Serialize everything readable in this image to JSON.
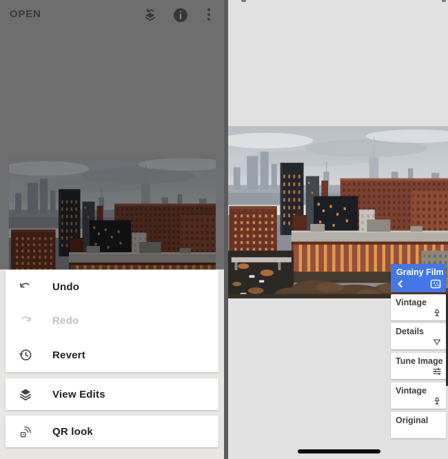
{
  "left_screen": {
    "toolbar": {
      "open_label": "OPEN",
      "icons": [
        "view-edits-history-icon",
        "info-icon",
        "overflow-menu-icon"
      ]
    },
    "menu": {
      "items": [
        {
          "label": "Undo",
          "icon": "undo-icon",
          "enabled": true
        },
        {
          "label": "Redo",
          "icon": "redo-icon",
          "enabled": false
        },
        {
          "label": "Revert",
          "icon": "revert-history-icon",
          "enabled": true
        }
      ],
      "view_edits": {
        "label": "View Edits",
        "icon": "layers-icon"
      },
      "qr_look": {
        "label": "QR look",
        "icon": "qr-scan-icon"
      }
    },
    "photo": {
      "description": "New York City skyline photo, dimmed by open menu"
    }
  },
  "right_screen": {
    "photo": {
      "description": "New York City skyline photo"
    },
    "edit_stack": {
      "active": {
        "label": "Grainy Film",
        "icons": [
          "back-chevron-icon",
          "grain-adjust-icon"
        ]
      },
      "items": [
        {
          "label": "Vintage",
          "icon": "lamp-icon"
        },
        {
          "label": "Details",
          "icon": "triangle-icon"
        },
        {
          "label": "Tune Image",
          "icon": "tune-sliders-icon"
        },
        {
          "label": "Vintage",
          "icon": "lamp-icon"
        },
        {
          "label": "Original",
          "icon": ""
        }
      ]
    }
  },
  "colors": {
    "accent_blue": "#4377e8",
    "dimmed_toolbar_bg": "#6e6e6e",
    "menu_bg": "#e7e6e5",
    "right_bg": "#e1e1e1",
    "card_bg": "#ffffff",
    "text_dark": "#212121",
    "text_disabled": "#c0c0c0",
    "gesture_bar": "#090909"
  }
}
